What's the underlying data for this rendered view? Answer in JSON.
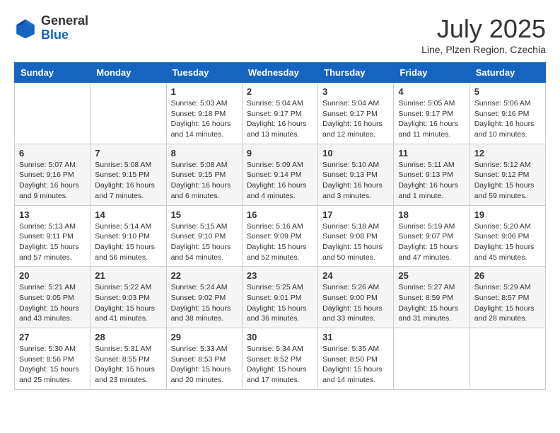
{
  "header": {
    "logo_general": "General",
    "logo_blue": "Blue",
    "month_year": "July 2025",
    "location": "Line, Plzen Region, Czechia"
  },
  "weekdays": [
    "Sunday",
    "Monday",
    "Tuesday",
    "Wednesday",
    "Thursday",
    "Friday",
    "Saturday"
  ],
  "weeks": [
    [
      {
        "day": "",
        "info": ""
      },
      {
        "day": "",
        "info": ""
      },
      {
        "day": "1",
        "info": "Sunrise: 5:03 AM\nSunset: 9:18 PM\nDaylight: 16 hours and 14 minutes."
      },
      {
        "day": "2",
        "info": "Sunrise: 5:04 AM\nSunset: 9:17 PM\nDaylight: 16 hours and 13 minutes."
      },
      {
        "day": "3",
        "info": "Sunrise: 5:04 AM\nSunset: 9:17 PM\nDaylight: 16 hours and 12 minutes."
      },
      {
        "day": "4",
        "info": "Sunrise: 5:05 AM\nSunset: 9:17 PM\nDaylight: 16 hours and 11 minutes."
      },
      {
        "day": "5",
        "info": "Sunrise: 5:06 AM\nSunset: 9:16 PM\nDaylight: 16 hours and 10 minutes."
      }
    ],
    [
      {
        "day": "6",
        "info": "Sunrise: 5:07 AM\nSunset: 9:16 PM\nDaylight: 16 hours and 9 minutes."
      },
      {
        "day": "7",
        "info": "Sunrise: 5:08 AM\nSunset: 9:15 PM\nDaylight: 16 hours and 7 minutes."
      },
      {
        "day": "8",
        "info": "Sunrise: 5:08 AM\nSunset: 9:15 PM\nDaylight: 16 hours and 6 minutes."
      },
      {
        "day": "9",
        "info": "Sunrise: 5:09 AM\nSunset: 9:14 PM\nDaylight: 16 hours and 4 minutes."
      },
      {
        "day": "10",
        "info": "Sunrise: 5:10 AM\nSunset: 9:13 PM\nDaylight: 16 hours and 3 minutes."
      },
      {
        "day": "11",
        "info": "Sunrise: 5:11 AM\nSunset: 9:13 PM\nDaylight: 16 hours and 1 minute."
      },
      {
        "day": "12",
        "info": "Sunrise: 5:12 AM\nSunset: 9:12 PM\nDaylight: 15 hours and 59 minutes."
      }
    ],
    [
      {
        "day": "13",
        "info": "Sunrise: 5:13 AM\nSunset: 9:11 PM\nDaylight: 15 hours and 57 minutes."
      },
      {
        "day": "14",
        "info": "Sunrise: 5:14 AM\nSunset: 9:10 PM\nDaylight: 15 hours and 56 minutes."
      },
      {
        "day": "15",
        "info": "Sunrise: 5:15 AM\nSunset: 9:10 PM\nDaylight: 15 hours and 54 minutes."
      },
      {
        "day": "16",
        "info": "Sunrise: 5:16 AM\nSunset: 9:09 PM\nDaylight: 15 hours and 52 minutes."
      },
      {
        "day": "17",
        "info": "Sunrise: 5:18 AM\nSunset: 9:08 PM\nDaylight: 15 hours and 50 minutes."
      },
      {
        "day": "18",
        "info": "Sunrise: 5:19 AM\nSunset: 9:07 PM\nDaylight: 15 hours and 47 minutes."
      },
      {
        "day": "19",
        "info": "Sunrise: 5:20 AM\nSunset: 9:06 PM\nDaylight: 15 hours and 45 minutes."
      }
    ],
    [
      {
        "day": "20",
        "info": "Sunrise: 5:21 AM\nSunset: 9:05 PM\nDaylight: 15 hours and 43 minutes."
      },
      {
        "day": "21",
        "info": "Sunrise: 5:22 AM\nSunset: 9:03 PM\nDaylight: 15 hours and 41 minutes."
      },
      {
        "day": "22",
        "info": "Sunrise: 5:24 AM\nSunset: 9:02 PM\nDaylight: 15 hours and 38 minutes."
      },
      {
        "day": "23",
        "info": "Sunrise: 5:25 AM\nSunset: 9:01 PM\nDaylight: 15 hours and 36 minutes."
      },
      {
        "day": "24",
        "info": "Sunrise: 5:26 AM\nSunset: 9:00 PM\nDaylight: 15 hours and 33 minutes."
      },
      {
        "day": "25",
        "info": "Sunrise: 5:27 AM\nSunset: 8:59 PM\nDaylight: 15 hours and 31 minutes."
      },
      {
        "day": "26",
        "info": "Sunrise: 5:29 AM\nSunset: 8:57 PM\nDaylight: 15 hours and 28 minutes."
      }
    ],
    [
      {
        "day": "27",
        "info": "Sunrise: 5:30 AM\nSunset: 8:56 PM\nDaylight: 15 hours and 25 minutes."
      },
      {
        "day": "28",
        "info": "Sunrise: 5:31 AM\nSunset: 8:55 PM\nDaylight: 15 hours and 23 minutes."
      },
      {
        "day": "29",
        "info": "Sunrise: 5:33 AM\nSunset: 8:53 PM\nDaylight: 15 hours and 20 minutes."
      },
      {
        "day": "30",
        "info": "Sunrise: 5:34 AM\nSunset: 8:52 PM\nDaylight: 15 hours and 17 minutes."
      },
      {
        "day": "31",
        "info": "Sunrise: 5:35 AM\nSunset: 8:50 PM\nDaylight: 15 hours and 14 minutes."
      },
      {
        "day": "",
        "info": ""
      },
      {
        "day": "",
        "info": ""
      }
    ]
  ]
}
